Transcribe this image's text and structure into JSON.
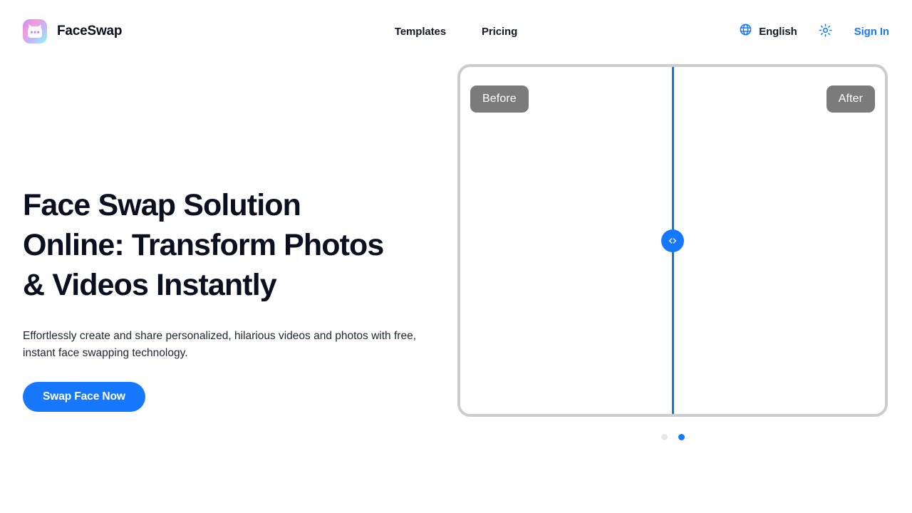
{
  "brand": {
    "name": "FaceSwap",
    "logo_icon": "cat-face-logo-icon",
    "logo_gradient_from": "#b98bfa",
    "logo_gradient_to": "#aef0e8"
  },
  "nav": {
    "items": [
      {
        "label": "Templates",
        "name": "nav-link-templates"
      },
      {
        "label": "Pricing",
        "name": "nav-link-pricing"
      }
    ]
  },
  "header_right": {
    "language": {
      "icon": "globe-icon",
      "label": "English"
    },
    "theme_toggle": {
      "icon": "sun-icon",
      "label": ""
    },
    "sign_in": {
      "label": "Sign In",
      "color": "#1677ff"
    }
  },
  "hero": {
    "title": "Face Swap Solution Online: Transform Photos & Videos Instantly",
    "subtitle": "Effortlessly create and share personalized, hilarious videos and photos with free, instant face swapping technology.",
    "cta_label": "Swap Face Now",
    "cta_color": "#1677ff",
    "title_color": "#0b1020"
  },
  "compare": {
    "before_label": "Before",
    "after_label": "After",
    "tag_bg": "#7b7b7b",
    "divider_color": "#0d7ad6",
    "handle_color": "#1677ff",
    "handle_icon": "chevron-left-right-icon",
    "handle_position_percent": 50,
    "frame_border_color": "#cccccc"
  },
  "carousel": {
    "dots": [
      {
        "active": false,
        "name": "carousel-dot-1"
      },
      {
        "active": true,
        "name": "carousel-dot-2"
      }
    ],
    "active_index": 1,
    "active_color": "#1677ff",
    "inactive_color": "#e6e8ea"
  }
}
